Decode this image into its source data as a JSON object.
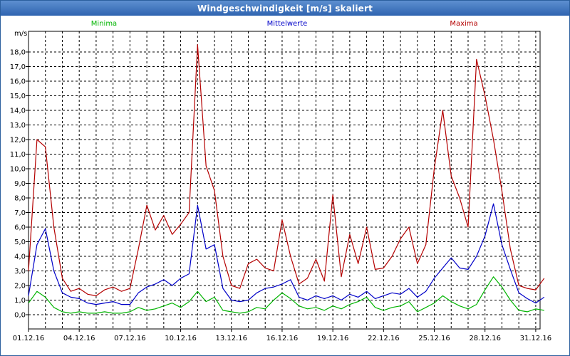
{
  "window": {
    "title": "Windgeschwindigkeit [m/s] skaliert"
  },
  "chart_data": {
    "type": "line",
    "title": "Windgeschwindigkeit [m/s] skaliert",
    "ylabel": "m/s",
    "xlabel": "",
    "ylim": [
      -0.5,
      19.0
    ],
    "xlim": [
      0,
      30.5
    ],
    "grid": true,
    "legend_placement": "top",
    "y_ticks": [
      "0,0",
      "1,0",
      "2,0",
      "3,0",
      "4,0",
      "5,0",
      "6,0",
      "7,0",
      "8,0",
      "9,0",
      "10,0",
      "11,0",
      "12,0",
      "13,0",
      "14,0",
      "15,0",
      "16,0",
      "17,0",
      "18,0"
    ],
    "x_ticks": [
      {
        "day": 0,
        "label": "01.12.16"
      },
      {
        "day": 3,
        "label": "04.12.16"
      },
      {
        "day": 6,
        "label": "07.12.16"
      },
      {
        "day": 9,
        "label": "10.12.16"
      },
      {
        "day": 12,
        "label": "13.12.16"
      },
      {
        "day": 15,
        "label": "16.12.16"
      },
      {
        "day": 18,
        "label": "19.12.16"
      },
      {
        "day": 21,
        "label": "22.12.16"
      },
      {
        "day": 24,
        "label": "25.12.16"
      },
      {
        "day": 27,
        "label": "28.12.16"
      },
      {
        "day": 30,
        "label": "31.12.16"
      }
    ],
    "series": [
      {
        "name": "Minima",
        "color": "#00b400",
        "key": "min",
        "x": [
          0,
          0.5,
          1,
          1.5,
          2,
          2.5,
          3,
          3.5,
          4,
          4.5,
          5,
          5.5,
          6,
          6.5,
          7,
          7.5,
          8,
          8.5,
          9,
          9.5,
          10,
          10.5,
          11,
          11.5,
          12,
          12.5,
          13,
          13.5,
          14,
          14.5,
          15,
          15.5,
          16,
          16.5,
          17,
          17.5,
          18,
          18.5,
          19,
          19.5,
          20,
          20.5,
          21,
          21.5,
          22,
          22.5,
          23,
          23.5,
          24,
          24.5,
          25,
          25.5,
          26,
          26.5,
          27,
          27.5,
          28,
          28.5,
          29,
          29.5,
          30,
          30.5
        ],
        "values": [
          0.8,
          1.6,
          1.2,
          0.5,
          0.2,
          0.1,
          0.2,
          0.1,
          0.1,
          0.2,
          0.1,
          0.1,
          0.2,
          0.5,
          0.3,
          0.4,
          0.6,
          0.8,
          0.5,
          0.9,
          1.6,
          0.9,
          1.2,
          0.3,
          0.2,
          0.1,
          0.2,
          0.5,
          0.4,
          1.0,
          1.5,
          1.1,
          0.6,
          0.4,
          0.5,
          0.3,
          0.6,
          0.4,
          0.7,
          0.9,
          1.2,
          0.5,
          0.3,
          0.5,
          0.6,
          0.9,
          0.2,
          0.5,
          0.8,
          1.3,
          0.9,
          0.6,
          0.4,
          0.7,
          1.7,
          2.6,
          1.9,
          1.0,
          0.3,
          0.2,
          0.4,
          0.3
        ]
      },
      {
        "name": "Mittelwerte",
        "color": "#0000c8",
        "key": "mean",
        "x": [
          0,
          0.5,
          1,
          1.5,
          2,
          2.5,
          3,
          3.5,
          4,
          4.5,
          5,
          5.5,
          6,
          6.5,
          7,
          7.5,
          8,
          8.5,
          9,
          9.5,
          10,
          10.5,
          11,
          11.5,
          12,
          12.5,
          13,
          13.5,
          14,
          14.5,
          15,
          15.5,
          16,
          16.5,
          17,
          17.5,
          18,
          18.5,
          19,
          19.5,
          20,
          20.5,
          21,
          21.5,
          22,
          22.5,
          23,
          23.5,
          24,
          24.5,
          25,
          25.5,
          26,
          26.5,
          27,
          27.5,
          28,
          28.5,
          29,
          29.5,
          30,
          30.5
        ],
        "values": [
          1.3,
          4.8,
          5.9,
          3.0,
          1.5,
          1.2,
          1.1,
          0.8,
          0.7,
          0.8,
          0.9,
          0.7,
          0.7,
          1.5,
          1.9,
          2.1,
          2.4,
          2.0,
          2.5,
          2.8,
          7.5,
          4.5,
          4.8,
          1.8,
          1.0,
          0.9,
          1.0,
          1.5,
          1.8,
          1.9,
          2.1,
          2.4,
          1.2,
          1.0,
          1.3,
          1.1,
          1.3,
          1.0,
          1.4,
          1.2,
          1.6,
          1.1,
          1.3,
          1.5,
          1.4,
          1.8,
          1.2,
          1.6,
          2.5,
          3.2,
          3.9,
          3.2,
          3.1,
          4.0,
          5.4,
          7.6,
          4.8,
          3.1,
          1.5,
          1.1,
          0.8,
          1.2
        ]
      },
      {
        "name": "Maxima",
        "color": "#b40000",
        "key": "max",
        "x": [
          0,
          0.5,
          1,
          1.5,
          2,
          2.5,
          3,
          3.5,
          4,
          4.5,
          5,
          5.5,
          6,
          6.5,
          7,
          7.5,
          8,
          8.5,
          9,
          9.5,
          10,
          10.5,
          11,
          11.5,
          12,
          12.5,
          13,
          13.5,
          14,
          14.5,
          15,
          15.5,
          16,
          16.5,
          17,
          17.5,
          18,
          18.5,
          19,
          19.5,
          20,
          20.5,
          21,
          21.5,
          22,
          22.5,
          23,
          23.5,
          24,
          24.5,
          25,
          25.5,
          26,
          26.5,
          27,
          27.5,
          28,
          28.5,
          29,
          29.5,
          30,
          30.5
        ],
        "values": [
          3.0,
          12.0,
          11.5,
          6.0,
          2.5,
          1.6,
          1.8,
          1.4,
          1.3,
          1.7,
          1.9,
          1.6,
          1.8,
          4.5,
          7.5,
          5.8,
          6.8,
          5.5,
          6.2,
          7.0,
          18.5,
          10.2,
          8.5,
          4.0,
          2.0,
          1.8,
          3.5,
          3.8,
          3.2,
          3.0,
          6.5,
          4.0,
          2.1,
          2.5,
          3.8,
          2.3,
          8.2,
          2.6,
          5.5,
          3.5,
          6.0,
          3.1,
          3.2,
          4.0,
          5.2,
          6.0,
          3.5,
          4.8,
          10.0,
          14.0,
          9.5,
          8.0,
          6.0,
          17.5,
          15.0,
          12.0,
          8.5,
          4.5,
          2.0,
          1.8,
          1.7,
          2.5
        ]
      }
    ]
  }
}
